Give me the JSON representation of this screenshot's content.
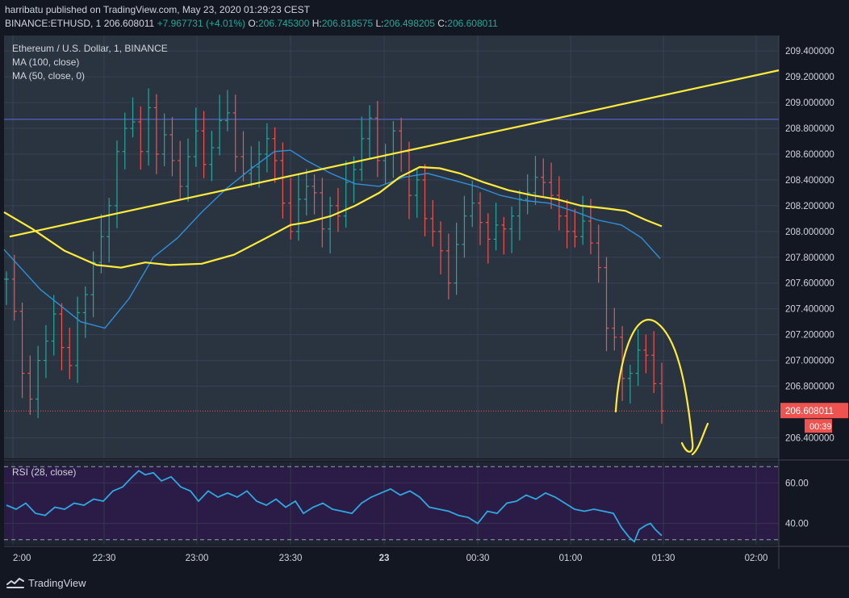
{
  "header": {
    "publisher_line": "harribatu published on TradingView.com, May 23, 2020 01:29:23 CEST",
    "symbol": "BINANCE:ETHUSD, 1",
    "last": "206.608011",
    "change": "+7.967731 (+4.01%)",
    "o_label": "O:",
    "o_value": "206.745300",
    "h_label": "H:",
    "h_value": "206.818575",
    "l_label": "L:",
    "l_value": "206.498205",
    "c_label": "C:",
    "c_value": "206.608011"
  },
  "legend": {
    "title": "Ethereum / U.S. Dollar, 1, BINANCE",
    "ma100": "MA (100, close)",
    "ma50": "MA (50, close, 0)"
  },
  "rsi": {
    "label": "RSI (28, close)"
  },
  "price_badge": {
    "value": "206.608011",
    "countdown": "00:39"
  },
  "brand": {
    "name": "TradingView"
  },
  "colors": {
    "background": "#131722",
    "pane": "#2a3441",
    "rsi_band": "#2b1b47",
    "up": "#26a69a",
    "down": "#ef5350",
    "ma": "#2f8fd8",
    "annotation": "#ffeb3b",
    "rsi_line": "#2fa8e0"
  },
  "chart_data": {
    "type": "line",
    "price_axis": {
      "ticks": [
        "209.400000",
        "209.200000",
        "209.000000",
        "208.800000",
        "208.600000",
        "208.400000",
        "208.200000",
        "208.000000",
        "207.800000",
        "207.600000",
        "207.400000",
        "207.200000",
        "207.000000",
        "206.800000",
        "206.400000"
      ],
      "range": [
        206.24,
        209.52
      ]
    },
    "rsi_axis": {
      "ticks": [
        "60.00",
        "40.00"
      ],
      "range": [
        29.5,
        70.5
      ],
      "bands": [
        68,
        32
      ]
    },
    "time_axis": {
      "labels": [
        "2:00",
        "22:30",
        "23:00",
        "23:30",
        "23",
        "00:30",
        "01:00",
        "01:30",
        "02:00"
      ]
    },
    "horizontal_line": 208.87,
    "last_price": 206.608011,
    "candles": [
      207.63,
      207.38,
      206.9,
      206.7,
      207.0,
      207.15,
      207.36,
      207.1,
      206.96,
      207.37,
      207.51,
      207.76,
      207.96,
      208.2,
      208.62,
      208.8,
      208.85,
      208.62,
      208.96,
      208.6,
      208.75,
      208.55,
      208.35,
      208.58,
      208.78,
      208.52,
      208.65,
      208.86,
      208.92,
      208.58,
      208.45,
      208.5,
      208.6,
      208.72,
      208.55,
      208.22,
      208.0,
      208.25,
      208.35,
      208.3,
      208.02,
      208.2,
      208.12,
      208.38,
      208.48,
      208.72,
      208.88,
      208.55,
      208.6,
      208.78,
      208.62,
      208.28,
      208.4,
      208.1,
      208.0,
      207.85,
      207.6,
      207.9,
      208.12,
      208.22,
      208.07,
      207.94,
      208.05,
      208.02,
      208.12,
      208.25,
      208.3,
      208.42,
      208.38,
      208.28,
      208.12,
      208.0,
      207.96,
      208.08,
      207.91,
      207.72,
      207.25,
      207.18,
      206.86,
      206.9,
      207.08,
      207.04,
      206.82,
      206.608011
    ],
    "ma50": [
      [
        5,
        207.86
      ],
      [
        50,
        207.55
      ],
      [
        100,
        207.3
      ],
      [
        130,
        207.25
      ],
      [
        160,
        207.48
      ],
      [
        190,
        207.8
      ],
      [
        220,
        207.95
      ],
      [
        250,
        208.15
      ],
      [
        280,
        208.33
      ],
      [
        310,
        208.48
      ],
      [
        340,
        208.62
      ],
      [
        360,
        208.63
      ],
      [
        380,
        208.55
      ],
      [
        410,
        208.45
      ],
      [
        440,
        208.37
      ],
      [
        470,
        208.35
      ],
      [
        500,
        208.42
      ],
      [
        530,
        208.45
      ],
      [
        560,
        208.4
      ],
      [
        590,
        208.35
      ],
      [
        620,
        208.28
      ],
      [
        650,
        208.24
      ],
      [
        680,
        208.22
      ],
      [
        710,
        208.16
      ],
      [
        740,
        208.09
      ],
      [
        770,
        208.05
      ],
      [
        795,
        207.95
      ],
      [
        818,
        207.79
      ]
    ],
    "ma100": [
      [
        5,
        208.15
      ],
      [
        40,
        208.02
      ],
      [
        80,
        207.85
      ],
      [
        120,
        207.74
      ],
      [
        150,
        207.72
      ],
      [
        180,
        207.76
      ],
      [
        210,
        207.74
      ],
      [
        250,
        207.75
      ],
      [
        290,
        207.82
      ],
      [
        330,
        207.95
      ],
      [
        360,
        208.05
      ],
      [
        380,
        208.07
      ],
      [
        410,
        208.12
      ],
      [
        440,
        208.2
      ],
      [
        470,
        208.3
      ],
      [
        495,
        208.42
      ],
      [
        520,
        208.5
      ],
      [
        545,
        208.49
      ],
      [
        570,
        208.45
      ],
      [
        600,
        208.38
      ],
      [
        630,
        208.32
      ],
      [
        660,
        208.28
      ],
      [
        690,
        208.25
      ],
      [
        720,
        208.2
      ],
      [
        750,
        208.18
      ],
      [
        775,
        208.16
      ],
      [
        800,
        208.09
      ],
      [
        820,
        208.04
      ]
    ],
    "trendline": [
      [
        12,
        207.96
      ],
      [
        965,
        209.25
      ]
    ],
    "rsi": [
      [
        8,
        49
      ],
      [
        20,
        47
      ],
      [
        32,
        50
      ],
      [
        44,
        45
      ],
      [
        56,
        44
      ],
      [
        68,
        48
      ],
      [
        80,
        47
      ],
      [
        92,
        50
      ],
      [
        104,
        49
      ],
      [
        116,
        52
      ],
      [
        128,
        51
      ],
      [
        140,
        56
      ],
      [
        152,
        58
      ],
      [
        164,
        63
      ],
      [
        172,
        66
      ],
      [
        180,
        64
      ],
      [
        190,
        65
      ],
      [
        200,
        61
      ],
      [
        212,
        63
      ],
      [
        224,
        58
      ],
      [
        236,
        56
      ],
      [
        246,
        51
      ],
      [
        258,
        56
      ],
      [
        270,
        53
      ],
      [
        282,
        55
      ],
      [
        294,
        53
      ],
      [
        306,
        56
      ],
      [
        318,
        51
      ],
      [
        330,
        49
      ],
      [
        342,
        52
      ],
      [
        354,
        48
      ],
      [
        366,
        51
      ],
      [
        376,
        45
      ],
      [
        388,
        48
      ],
      [
        400,
        50
      ],
      [
        412,
        47
      ],
      [
        424,
        46
      ],
      [
        436,
        45
      ],
      [
        448,
        50
      ],
      [
        460,
        53
      ],
      [
        472,
        55
      ],
      [
        484,
        57
      ],
      [
        496,
        54
      ],
      [
        508,
        56
      ],
      [
        520,
        53
      ],
      [
        532,
        48
      ],
      [
        544,
        47
      ],
      [
        556,
        46
      ],
      [
        568,
        44
      ],
      [
        580,
        43
      ],
      [
        592,
        40
      ],
      [
        604,
        46
      ],
      [
        616,
        45
      ],
      [
        628,
        50
      ],
      [
        640,
        51
      ],
      [
        652,
        54
      ],
      [
        664,
        52
      ],
      [
        676,
        55
      ],
      [
        688,
        53
      ],
      [
        700,
        50
      ],
      [
        712,
        47
      ],
      [
        724,
        46
      ],
      [
        736,
        47
      ],
      [
        748,
        46
      ],
      [
        760,
        45
      ],
      [
        770,
        38
      ],
      [
        780,
        33
      ],
      [
        786,
        31
      ],
      [
        792,
        37
      ],
      [
        800,
        39
      ],
      [
        806,
        40
      ],
      [
        812,
        37
      ],
      [
        820,
        34
      ]
    ],
    "annotations": {
      "arrow_curve": "cup-shaped arc drawn above the drop with a downward-curving arrow to the right"
    }
  }
}
